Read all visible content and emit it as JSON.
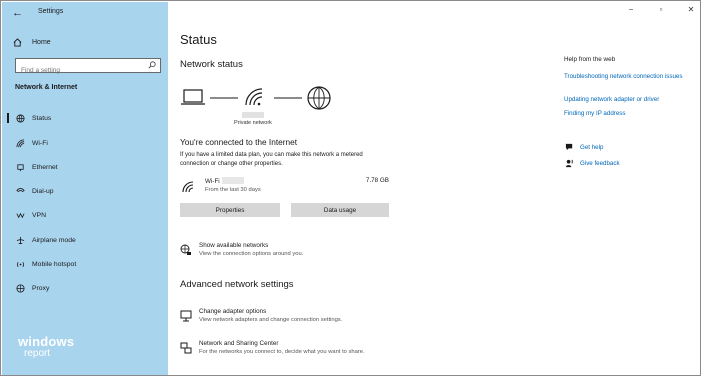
{
  "window": {
    "app_title": "Settings",
    "controls": {
      "minimize": "−",
      "maximize": "▫",
      "close": "✕"
    }
  },
  "sidebar": {
    "home_label": "Home",
    "search_placeholder": "Find a setting",
    "section_label": "Network & Internet",
    "items": [
      {
        "label": "Status",
        "icon": "globe-icon",
        "active": true
      },
      {
        "label": "Wi-Fi",
        "icon": "wifi-icon"
      },
      {
        "label": "Ethernet",
        "icon": "ethernet-icon"
      },
      {
        "label": "Dial-up",
        "icon": "dialup-icon"
      },
      {
        "label": "VPN",
        "icon": "vpn-icon"
      },
      {
        "label": "Airplane mode",
        "icon": "airplane-icon"
      },
      {
        "label": "Mobile hotspot",
        "icon": "hotspot-icon"
      },
      {
        "label": "Proxy",
        "icon": "proxy-icon"
      }
    ],
    "brand_line1": "windows",
    "brand_line2": "report"
  },
  "main": {
    "page_title": "Status",
    "network_status_heading": "Network status",
    "diagram_label": "Private network",
    "connected_title": "You're connected to the Internet",
    "connected_desc": "If you have a limited data plan, you can make this network a metered connection or change other properties.",
    "wifi": {
      "name": "Wi-Fi",
      "sub": "From the last 30 days",
      "usage": "7.78 GB"
    },
    "buttons": {
      "properties": "Properties",
      "data_usage": "Data usage"
    },
    "show_networks": {
      "title": "Show available networks",
      "desc": "View the connection options around you."
    },
    "advanced_heading": "Advanced network settings",
    "change_adapter": {
      "title": "Change adapter options",
      "desc": "View network adapters and change connection settings."
    },
    "sharing_center": {
      "title": "Network and Sharing Center",
      "desc": "For the networks you connect to, decide what you want to share."
    }
  },
  "help": {
    "title": "Help from the web",
    "links": [
      "Troubleshooting network connection issues",
      "Updating network adapter or driver",
      "Finding my IP address"
    ],
    "get_help": "Get help",
    "give_feedback": "Give feedback"
  }
}
